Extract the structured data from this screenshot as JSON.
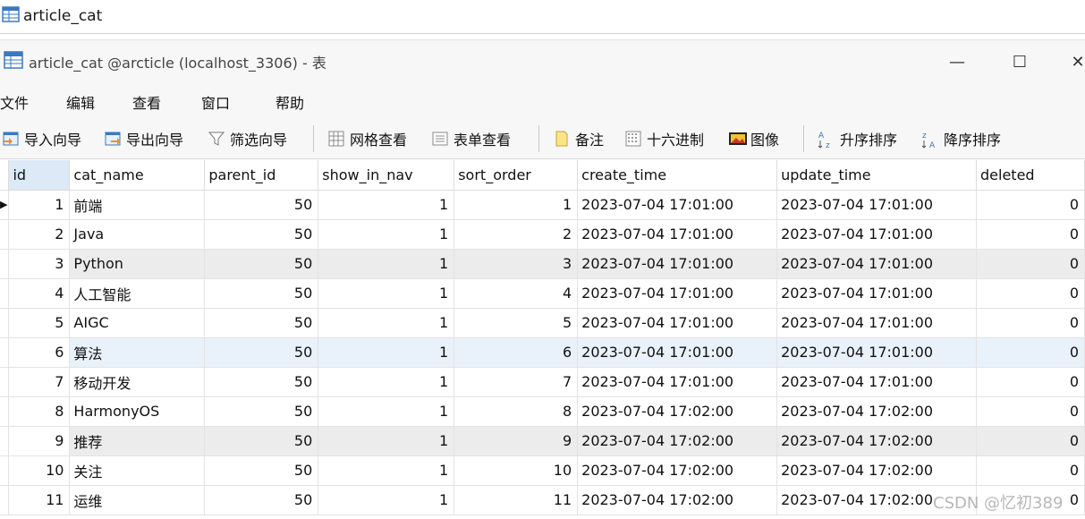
{
  "tab": {
    "label": "article_cat"
  },
  "window": {
    "title": "article_cat @arcticle (localhost_3306) - 表",
    "minimize": "—",
    "maximize": "☐",
    "close": "✕"
  },
  "menu": [
    "文件",
    "编辑",
    "查看",
    "窗口",
    "帮助"
  ],
  "toolbar": {
    "import_wizard": "导入向导",
    "export_wizard": "导出向导",
    "filter_wizard": "筛选向导",
    "grid_view": "网格查看",
    "form_view": "表单查看",
    "memo": "备注",
    "hex": "十六进制",
    "image": "图像",
    "sort_asc": "升序排序",
    "sort_desc": "降序排序"
  },
  "table": {
    "columns": [
      "id",
      "cat_name",
      "parent_id",
      "show_in_nav",
      "sort_order",
      "create_time",
      "update_time",
      "deleted"
    ],
    "rows": [
      [
        "1",
        "前端",
        "50",
        "1",
        "1",
        "2023-07-04 17:01:00",
        "2023-07-04 17:01:00",
        "0"
      ],
      [
        "2",
        "Java",
        "50",
        "1",
        "2",
        "2023-07-04 17:01:00",
        "2023-07-04 17:01:00",
        "0"
      ],
      [
        "3",
        "Python",
        "50",
        "1",
        "3",
        "2023-07-04 17:01:00",
        "2023-07-04 17:01:00",
        "0"
      ],
      [
        "4",
        "人工智能",
        "50",
        "1",
        "4",
        "2023-07-04 17:01:00",
        "2023-07-04 17:01:00",
        "0"
      ],
      [
        "5",
        "AIGC",
        "50",
        "1",
        "5",
        "2023-07-04 17:01:00",
        "2023-07-04 17:01:00",
        "0"
      ],
      [
        "6",
        "算法",
        "50",
        "1",
        "6",
        "2023-07-04 17:01:00",
        "2023-07-04 17:01:00",
        "0"
      ],
      [
        "7",
        "移动开发",
        "50",
        "1",
        "7",
        "2023-07-04 17:01:00",
        "2023-07-04 17:01:00",
        "0"
      ],
      [
        "8",
        "HarmonyOS",
        "50",
        "1",
        "8",
        "2023-07-04 17:02:00",
        "2023-07-04 17:02:00",
        "0"
      ],
      [
        "9",
        "推荐",
        "50",
        "1",
        "9",
        "2023-07-04 17:02:00",
        "2023-07-04 17:02:00",
        "0"
      ],
      [
        "10",
        "关注",
        "50",
        "1",
        "10",
        "2023-07-04 17:02:00",
        "2023-07-04 17:02:00",
        "0"
      ],
      [
        "11",
        "运维",
        "50",
        "1",
        "11",
        "2023-07-04 17:02:00",
        "2023-07-04 17:02:00",
        "0"
      ]
    ]
  },
  "watermark": "CSDN @忆初389",
  "colors": {
    "header_selected": "#dce9f6",
    "row_alt": "#ececec",
    "row_selected": "#e9f1fa"
  }
}
